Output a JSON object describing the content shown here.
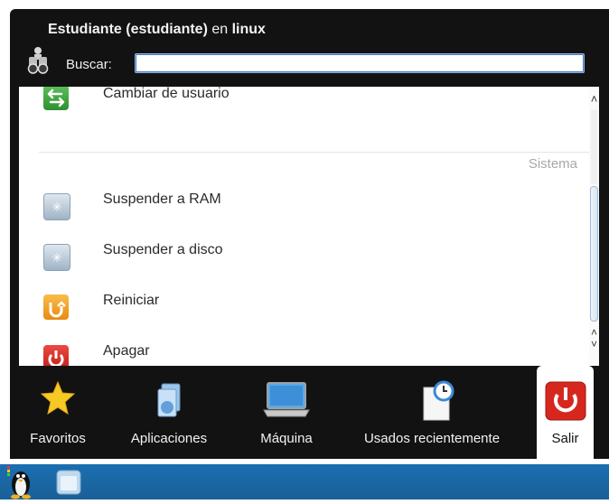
{
  "header": {
    "user_name": "Estudiante (estudiante)",
    "connector": "en",
    "host": "linux"
  },
  "search": {
    "label": "Buscar:",
    "value": ""
  },
  "list": {
    "partial_item": "Cambiar de usuario",
    "section": "Sistema",
    "items": [
      {
        "label": "Suspender a RAM",
        "icon": "suspend-icon"
      },
      {
        "label": "Suspender a disco",
        "icon": "suspend-icon"
      },
      {
        "label": "Reiniciar",
        "icon": "restart-icon"
      },
      {
        "label": "Apagar",
        "icon": "power-icon"
      }
    ]
  },
  "tabs": [
    {
      "label": "Favoritos",
      "icon": "star-icon"
    },
    {
      "label": "Aplicaciones",
      "icon": "applications-icon"
    },
    {
      "label": "Máquina",
      "icon": "computer-icon"
    },
    {
      "label": "Usados recientemente",
      "icon": "recent-documents-icon"
    },
    {
      "label": "Salir",
      "icon": "power-icon",
      "active": true
    }
  ],
  "colors": {
    "panel_background": "#121212",
    "taskbar": "#1a66a4",
    "power_red": "#d52a24",
    "restart_orange": "#f09a1a",
    "switch_user_green": "#3aa63a"
  }
}
